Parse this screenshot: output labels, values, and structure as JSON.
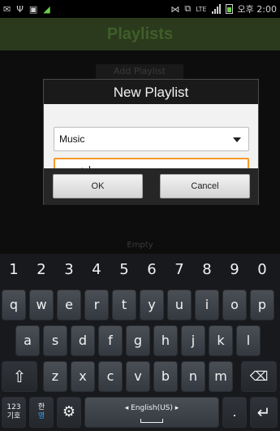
{
  "status_bar": {
    "time": "오후 2:00",
    "network": "LTE"
  },
  "app": {
    "title": "Playlists",
    "add_playlist_label": "Add Playlist",
    "empty_label": "Empty"
  },
  "dialog": {
    "title": "New Playlist",
    "select_value": "Music",
    "input_value": "music",
    "ok_label": "OK",
    "cancel_label": "Cancel"
  },
  "keyboard": {
    "number_row": [
      "1",
      "2",
      "3",
      "4",
      "5",
      "6",
      "7",
      "8",
      "9",
      "0"
    ],
    "row1": [
      "q",
      "w",
      "e",
      "r",
      "t",
      "y",
      "u",
      "i",
      "o",
      "p"
    ],
    "row2": [
      "a",
      "s",
      "d",
      "f",
      "g",
      "h",
      "j",
      "k",
      "l"
    ],
    "row3": [
      "z",
      "x",
      "c",
      "v",
      "b",
      "n",
      "m"
    ],
    "mode_key_top": "123",
    "mode_key_bottom": "기호",
    "lang_key_top": "한",
    "lang_key_bottom": "영",
    "space_label": "◂ English(US) ▸",
    "period_label": "."
  },
  "colors": {
    "accent": "#f39a2b",
    "appbar": "#2b3a1c"
  }
}
